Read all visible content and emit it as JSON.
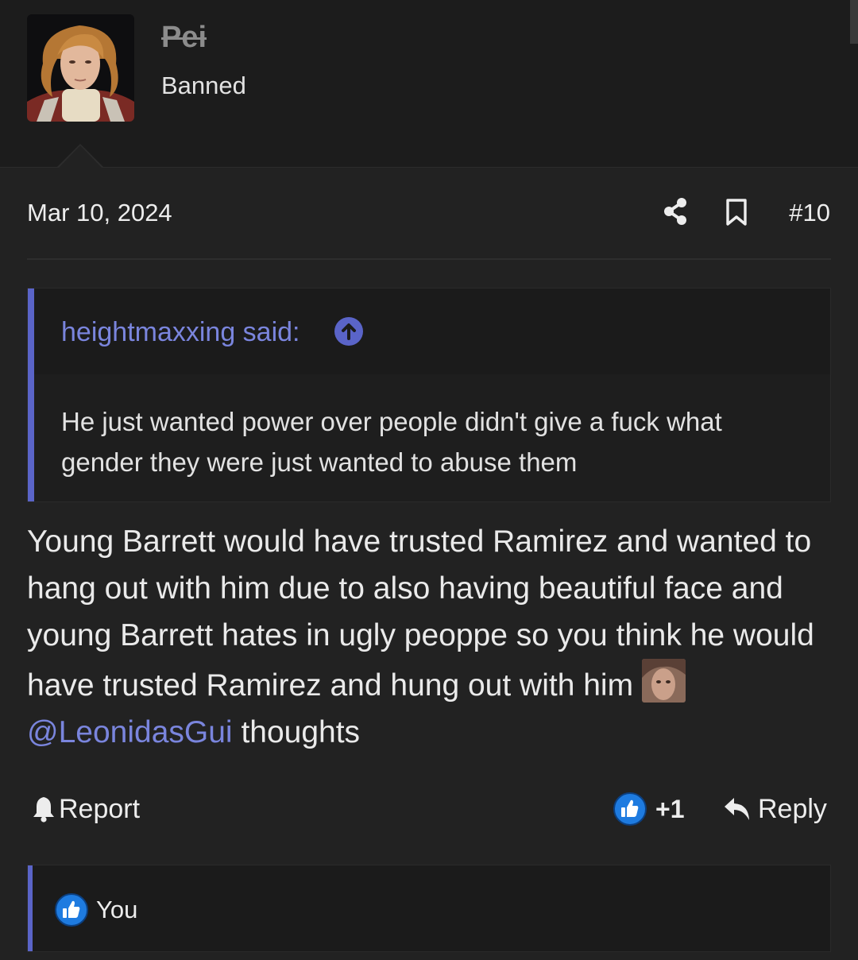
{
  "user": {
    "name": "Pei",
    "title": "Banned"
  },
  "post": {
    "date": "Mar 10, 2024",
    "number": "#10"
  },
  "quote": {
    "author": "heightmaxxing said:",
    "text": "He just wanted power over people didn't give a fuck what gender they were just wanted to abuse them"
  },
  "message": {
    "text_before": "Young Barrett would have trusted Ramirez and wanted to hang out with him due to also having beautiful face and young Barrett hates in ugly peoppe so you think he would have trusted Ramirez and hung out with him",
    "mention": "@LeonidasGui",
    "text_after": "thoughts"
  },
  "actions": {
    "report": "Report",
    "reaction_count": "+1",
    "reply": "Reply"
  },
  "reactions": {
    "list": "You"
  },
  "colors": {
    "accent": "#5a64c8",
    "link": "#7a85dd",
    "like": "#1e7be0",
    "background": "#222222"
  },
  "icons": [
    "share-icon",
    "bookmark-icon",
    "arrow-up-circle-icon",
    "bell-icon",
    "like-icon",
    "reply-arrow-icon"
  ]
}
